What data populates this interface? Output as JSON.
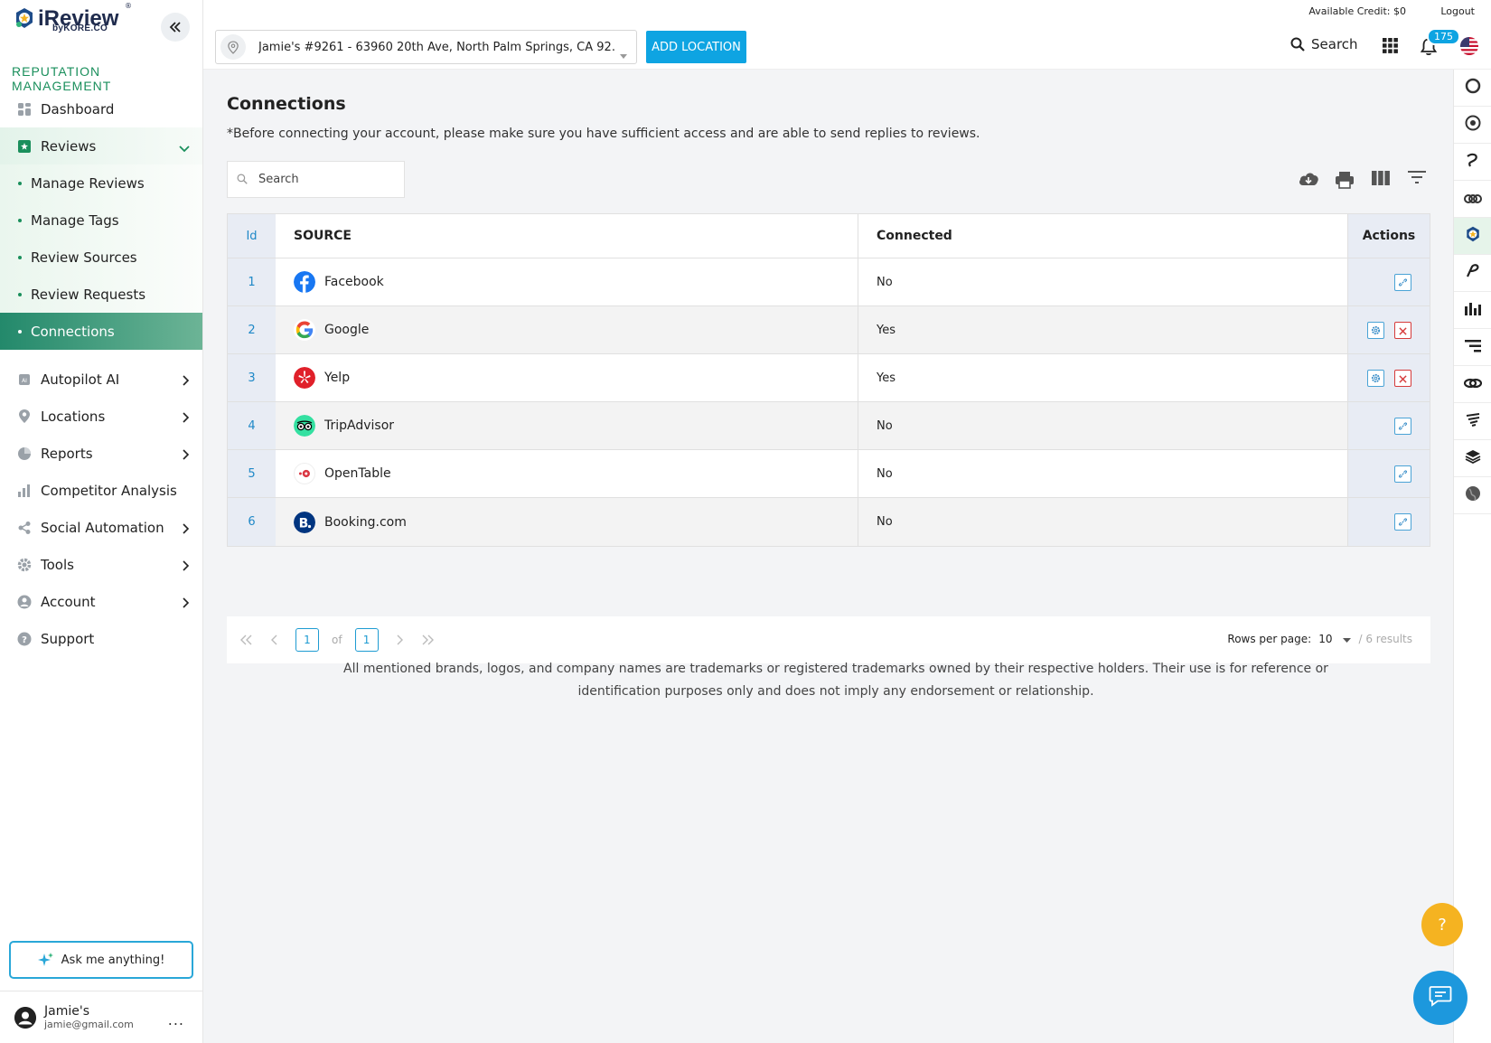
{
  "brand": {
    "name": "iReview",
    "byline": "byKORE.CO",
    "reg": "®",
    "section": "REPUTATION MANAGEMENT"
  },
  "sidebar": {
    "items": [
      {
        "label": "Dashboard",
        "icon": "dashboard-icon"
      },
      {
        "label": "Reviews",
        "icon": "reviews-icon"
      },
      {
        "label": "Autopilot AI",
        "icon": "ai-chip-icon"
      },
      {
        "label": "Locations",
        "icon": "location-pin-icon"
      },
      {
        "label": "Reports",
        "icon": "pie-chart-icon"
      },
      {
        "label": "Competitor Analysis",
        "icon": "bar-chart-icon"
      },
      {
        "label": "Social Automation",
        "icon": "social-icon"
      },
      {
        "label": "Tools",
        "icon": "gear-icon"
      },
      {
        "label": "Account",
        "icon": "user-circle-icon"
      },
      {
        "label": "Support",
        "icon": "help-circle-icon"
      }
    ],
    "reviews_sub": [
      "Manage Reviews",
      "Manage Tags",
      "Review Sources",
      "Review Requests",
      "Connections"
    ],
    "ask_label": "Ask me anything!",
    "user": {
      "name": "Jamie's",
      "email": "jamie@gmail.com",
      "more": "..."
    }
  },
  "header": {
    "credit": "Available Credit: $0",
    "logout": "Logout",
    "location": "Jamie's #9261 - 63960 20th Ave, North Palm Springs, CA 92...",
    "add_location": "ADD LOCATION",
    "search": "Search",
    "notifications": "175"
  },
  "page": {
    "title": "Connections",
    "note": "*Before connecting your account, please make sure you have sufficient access and are able to send replies to reviews.",
    "search_placeholder": "Search",
    "columns": {
      "id": "Id",
      "source": "SOURCE",
      "connected": "Connected",
      "actions": "Actions"
    },
    "rows": [
      {
        "id": "1",
        "source": "Facebook",
        "connected": "No",
        "logo": "facebook-logo"
      },
      {
        "id": "2",
        "source": "Google",
        "connected": "Yes",
        "logo": "google-logo"
      },
      {
        "id": "3",
        "source": "Yelp",
        "connected": "Yes",
        "logo": "yelp-logo"
      },
      {
        "id": "4",
        "source": "TripAdvisor",
        "connected": "No",
        "logo": "tripadvisor-logo"
      },
      {
        "id": "5",
        "source": "OpenTable",
        "connected": "No",
        "logo": "opentable-logo"
      },
      {
        "id": "6",
        "source": "Booking.com",
        "connected": "No",
        "logo": "booking-logo"
      }
    ],
    "pager": {
      "page": "1",
      "of": "of",
      "total": "1",
      "rows_label": "Rows per page:",
      "rows_value": "10",
      "results": "/ 6 results"
    },
    "disclaimer": "All mentioned brands, logos, and company names are trademarks or registered trademarks owned by their respective holders. Their use is for reference or identification purposes only and does not imply any endorsement or relationship.",
    "help": "?"
  },
  "colors": {
    "accent": "#0ea4e2",
    "brand_green": "#1a8f5c",
    "active_nav": "#23896b",
    "help": "#f5b321"
  }
}
